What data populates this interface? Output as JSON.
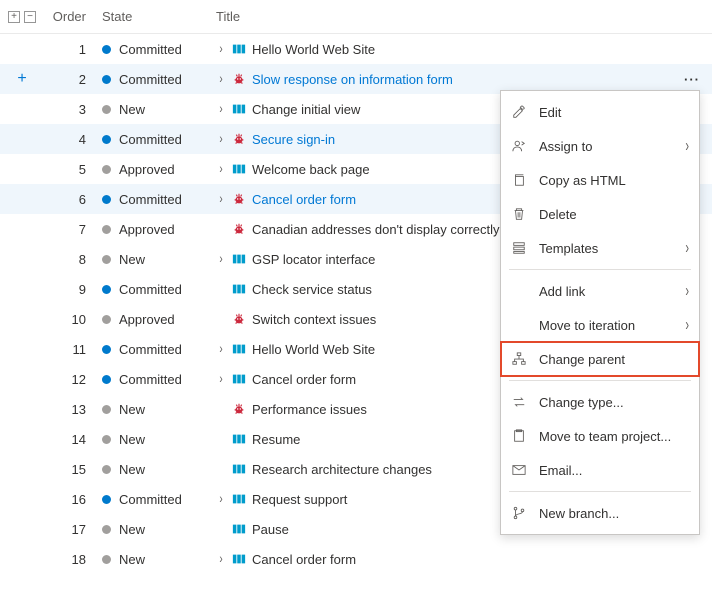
{
  "columns": {
    "order": "Order",
    "state": "State",
    "title": "Title"
  },
  "rows": [
    {
      "order": 1,
      "state": "Committed",
      "stateColor": "blue",
      "hasChildren": true,
      "type": "pbi",
      "title": "Hello World Web Site",
      "selected": false,
      "showAdd": false,
      "showActions": false,
      "link": false
    },
    {
      "order": 2,
      "state": "Committed",
      "stateColor": "blue",
      "hasChildren": true,
      "type": "bug",
      "title": "Slow response on information form",
      "selected": true,
      "showAdd": true,
      "showActions": true,
      "link": true
    },
    {
      "order": 3,
      "state": "New",
      "stateColor": "gray",
      "hasChildren": true,
      "type": "pbi",
      "title": "Change initial view",
      "selected": false,
      "showAdd": false,
      "showActions": false,
      "link": false
    },
    {
      "order": 4,
      "state": "Committed",
      "stateColor": "blue",
      "hasChildren": true,
      "type": "bug",
      "title": "Secure sign-in",
      "selected": true,
      "showAdd": false,
      "showActions": true,
      "link": true
    },
    {
      "order": 5,
      "state": "Approved",
      "stateColor": "gray",
      "hasChildren": true,
      "type": "pbi",
      "title": "Welcome back page",
      "selected": false,
      "showAdd": false,
      "showActions": false,
      "link": false
    },
    {
      "order": 6,
      "state": "Committed",
      "stateColor": "blue",
      "hasChildren": true,
      "type": "bug",
      "title": "Cancel order form",
      "selected": true,
      "showAdd": false,
      "showActions": true,
      "link": true
    },
    {
      "order": 7,
      "state": "Approved",
      "stateColor": "gray",
      "hasChildren": false,
      "type": "bug",
      "title": "Canadian addresses don't display correctly",
      "selected": false,
      "showAdd": false,
      "showActions": false,
      "link": false
    },
    {
      "order": 8,
      "state": "New",
      "stateColor": "gray",
      "hasChildren": true,
      "type": "pbi",
      "title": "GSP locator interface",
      "selected": false,
      "showAdd": false,
      "showActions": false,
      "link": false
    },
    {
      "order": 9,
      "state": "Committed",
      "stateColor": "blue",
      "hasChildren": false,
      "type": "pbi",
      "title": "Check service status",
      "selected": false,
      "showAdd": false,
      "showActions": false,
      "link": false
    },
    {
      "order": 10,
      "state": "Approved",
      "stateColor": "gray",
      "hasChildren": false,
      "type": "bug",
      "title": "Switch context issues",
      "selected": false,
      "showAdd": false,
      "showActions": false,
      "link": false
    },
    {
      "order": 11,
      "state": "Committed",
      "stateColor": "blue",
      "hasChildren": true,
      "type": "pbi",
      "title": "Hello World Web Site",
      "selected": false,
      "showAdd": false,
      "showActions": false,
      "link": false
    },
    {
      "order": 12,
      "state": "Committed",
      "stateColor": "blue",
      "hasChildren": true,
      "type": "pbi",
      "title": "Cancel order form",
      "selected": false,
      "showAdd": false,
      "showActions": false,
      "link": false
    },
    {
      "order": 13,
      "state": "New",
      "stateColor": "gray",
      "hasChildren": false,
      "type": "bug",
      "title": "Performance issues",
      "selected": false,
      "showAdd": false,
      "showActions": false,
      "link": false
    },
    {
      "order": 14,
      "state": "New",
      "stateColor": "gray",
      "hasChildren": false,
      "type": "pbi",
      "title": "Resume",
      "selected": false,
      "showAdd": false,
      "showActions": false,
      "link": false
    },
    {
      "order": 15,
      "state": "New",
      "stateColor": "gray",
      "hasChildren": false,
      "type": "pbi",
      "title": "Research architecture changes",
      "selected": false,
      "showAdd": false,
      "showActions": false,
      "link": false
    },
    {
      "order": 16,
      "state": "Committed",
      "stateColor": "blue",
      "hasChildren": true,
      "type": "pbi",
      "title": "Request support",
      "selected": false,
      "showAdd": false,
      "showActions": false,
      "link": false
    },
    {
      "order": 17,
      "state": "New",
      "stateColor": "gray",
      "hasChildren": false,
      "type": "pbi",
      "title": "Pause",
      "selected": false,
      "showAdd": false,
      "showActions": false,
      "link": false
    },
    {
      "order": 18,
      "state": "New",
      "stateColor": "gray",
      "hasChildren": true,
      "type": "pbi",
      "title": "Cancel order form",
      "selected": false,
      "showAdd": false,
      "showActions": false,
      "link": false
    }
  ],
  "menu": {
    "edit": "Edit",
    "assign_to": "Assign to",
    "copy_html": "Copy as HTML",
    "delete": "Delete",
    "templates": "Templates",
    "add_link": "Add link",
    "move_iteration": "Move to iteration",
    "change_parent": "Change parent",
    "change_type": "Change type...",
    "move_project": "Move to team project...",
    "email": "Email...",
    "new_branch": "New branch..."
  }
}
